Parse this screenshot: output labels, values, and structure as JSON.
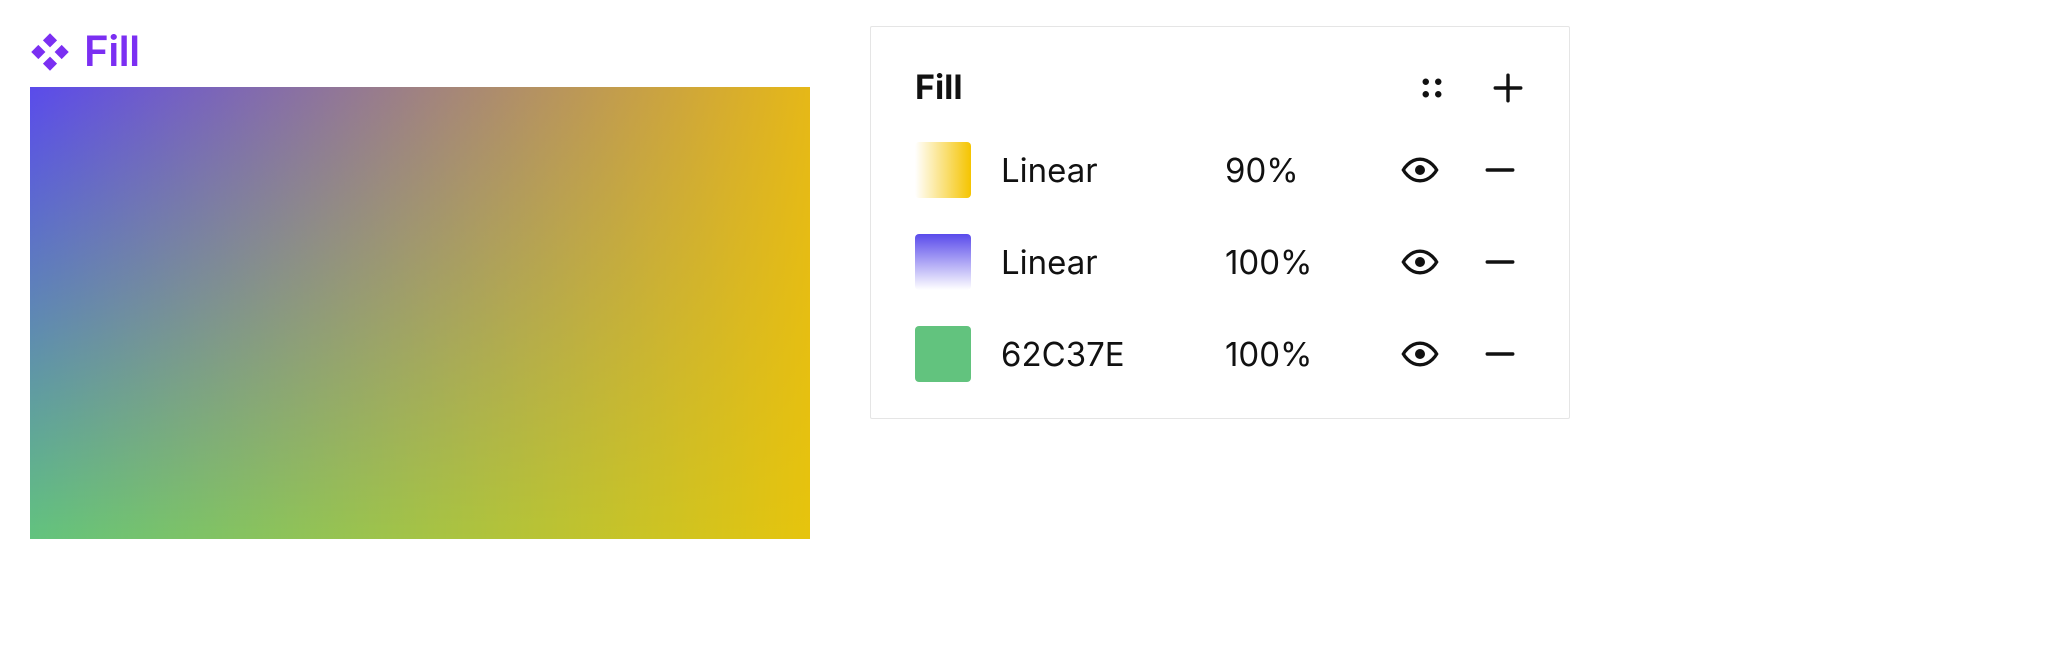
{
  "component": {
    "label": "Fill",
    "accent": "#7b2ff2"
  },
  "preview": {
    "layers": [
      {
        "css": "background: #62C37E;",
        "opacity": 1.0
      },
      {
        "css": "background: linear-gradient(180deg, #5A4BEB 0%, rgba(90,75,235,0) 100%);",
        "opacity": 1.0
      },
      {
        "css": "background: linear-gradient(90deg, rgba(255,255,255,0) 0%, #F5C400 100%);",
        "opacity": 0.9
      }
    ]
  },
  "panel": {
    "title": "Fill",
    "fills": [
      {
        "swatch_css": "linear-gradient(90deg, #ffffff 0%, #F5C400 100%)",
        "name": "Linear",
        "opacity": "90%"
      },
      {
        "swatch_css": "linear-gradient(180deg, #5A4BEB 0%, #ffffff 100%)",
        "name": "Linear",
        "opacity": "100%"
      },
      {
        "swatch_css": "#62C37E",
        "name": "62C37E",
        "opacity": "100%"
      }
    ]
  }
}
